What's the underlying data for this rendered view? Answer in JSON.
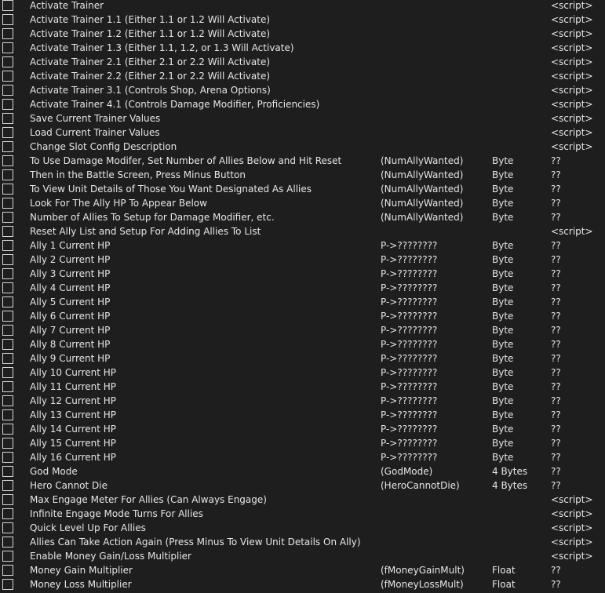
{
  "rows": [
    {
      "description": "Activate Trainer",
      "address": "",
      "type": "",
      "value": "<script>"
    },
    {
      "description": "Activate Trainer 1.1 (Either 1.1 or 1.2 Will Activate)",
      "address": "",
      "type": "",
      "value": "<script>"
    },
    {
      "description": "Activate Trainer 1.2 (Either 1.1 or 1.2 Will Activate)",
      "address": "",
      "type": "",
      "value": "<script>"
    },
    {
      "description": "Activate Trainer 1.3 (Either 1.1, 1.2, or 1.3 Will Activate)",
      "address": "",
      "type": "",
      "value": "<script>"
    },
    {
      "description": "Activate Trainer 2.1 (Either 2.1 or 2.2 Will Activate)",
      "address": "",
      "type": "",
      "value": "<script>"
    },
    {
      "description": "Activate Trainer 2.2 (Either 2.1 or 2.2 Will Activate)",
      "address": "",
      "type": "",
      "value": "<script>"
    },
    {
      "description": "Activate Trainer 3.1 (Controls Shop, Arena Options)",
      "address": "",
      "type": "",
      "value": "<script>"
    },
    {
      "description": "Activate Trainer 4.1 (Controls Damage Modifier, Proficiencies)",
      "address": "",
      "type": "",
      "value": "<script>"
    },
    {
      "description": "Save Current Trainer Values",
      "address": "",
      "type": "",
      "value": "<script>"
    },
    {
      "description": "Load Current Trainer Values",
      "address": "",
      "type": "",
      "value": "<script>"
    },
    {
      "description": "Change Slot Config Description",
      "address": "",
      "type": "",
      "value": "<script>"
    },
    {
      "description": "To Use Damage Modifer, Set Number of Allies Below and Hit Reset",
      "address": "(NumAllyWanted)",
      "type": "Byte",
      "value": "??"
    },
    {
      "description": "Then in the Battle Screen, Press Minus Button",
      "address": "(NumAllyWanted)",
      "type": "Byte",
      "value": "??"
    },
    {
      "description": "To View Unit Details of Those You Want Designated As Allies",
      "address": "(NumAllyWanted)",
      "type": "Byte",
      "value": "??"
    },
    {
      "description": "Look For The Ally HP To Appear Below",
      "address": "(NumAllyWanted)",
      "type": "Byte",
      "value": "??"
    },
    {
      "description": "Number of Allies To Setup for Damage Modifier, etc.",
      "address": "(NumAllyWanted)",
      "type": "Byte",
      "value": "??"
    },
    {
      "description": "Reset Ally List and Setup For Adding Allies To List",
      "address": "",
      "type": "",
      "value": "<script>"
    },
    {
      "description": "Ally 1 Current HP",
      "address": "P->????????",
      "type": "Byte",
      "value": "??"
    },
    {
      "description": "Ally 2 Current HP",
      "address": "P->????????",
      "type": "Byte",
      "value": "??"
    },
    {
      "description": "Ally 3 Current HP",
      "address": "P->????????",
      "type": "Byte",
      "value": "??"
    },
    {
      "description": "Ally 4 Current HP",
      "address": "P->????????",
      "type": "Byte",
      "value": "??"
    },
    {
      "description": "Ally 5 Current HP",
      "address": "P->????????",
      "type": "Byte",
      "value": "??"
    },
    {
      "description": "Ally 6 Current HP",
      "address": "P->????????",
      "type": "Byte",
      "value": "??"
    },
    {
      "description": "Ally 7 Current HP",
      "address": "P->????????",
      "type": "Byte",
      "value": "??"
    },
    {
      "description": "Ally 8 Current HP",
      "address": "P->????????",
      "type": "Byte",
      "value": "??"
    },
    {
      "description": "Ally 9 Current HP",
      "address": "P->????????",
      "type": "Byte",
      "value": "??"
    },
    {
      "description": "Ally 10 Current HP",
      "address": "P->????????",
      "type": "Byte",
      "value": "??"
    },
    {
      "description": "Ally 11 Current HP",
      "address": "P->????????",
      "type": "Byte",
      "value": "??"
    },
    {
      "description": "Ally 12 Current HP",
      "address": "P->????????",
      "type": "Byte",
      "value": "??"
    },
    {
      "description": "Ally 13 Current HP",
      "address": "P->????????",
      "type": "Byte",
      "value": "??"
    },
    {
      "description": "Ally 14 Current HP",
      "address": "P->????????",
      "type": "Byte",
      "value": "??"
    },
    {
      "description": "Ally 15 Current HP",
      "address": "P->????????",
      "type": "Byte",
      "value": "??"
    },
    {
      "description": "Ally 16 Current HP",
      "address": "P->????????",
      "type": "Byte",
      "value": "??"
    },
    {
      "description": "God Mode",
      "address": "(GodMode)",
      "type": "4 Bytes",
      "value": "??"
    },
    {
      "description": "Hero Cannot Die",
      "address": "(HeroCannotDie)",
      "type": "4 Bytes",
      "value": "??"
    },
    {
      "description": "Max Engage Meter For Allies (Can Always Engage)",
      "address": "",
      "type": "",
      "value": "<script>"
    },
    {
      "description": "Infinite Engage Mode Turns For Allies",
      "address": "",
      "type": "",
      "value": "<script>"
    },
    {
      "description": "Quick Level Up For Allies",
      "address": "",
      "type": "",
      "value": "<script>"
    },
    {
      "description": "Allies Can Take Action Again (Press Minus To View Unit Details On Ally)",
      "address": "",
      "type": "",
      "value": "<script>"
    },
    {
      "description": "Enable Money Gain/Loss Multiplier",
      "address": "",
      "type": "",
      "value": "<script>"
    },
    {
      "description": "Money Gain Multiplier",
      "address": "(fMoneyGainMult)",
      "type": "Float",
      "value": "??"
    },
    {
      "description": "Money Loss Multiplier",
      "address": "(fMoneyLossMult)",
      "type": "Float",
      "value": "??"
    }
  ]
}
